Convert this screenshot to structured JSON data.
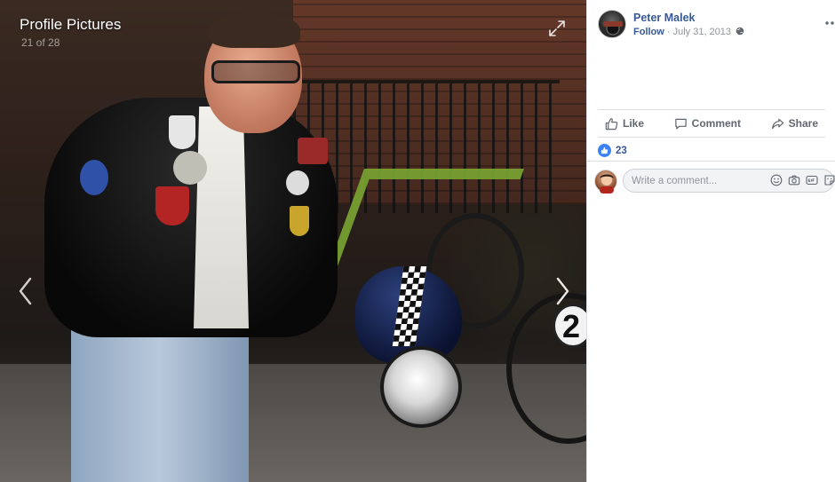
{
  "viewer": {
    "title": "Profile Pictures",
    "counter": "21 of 28",
    "photo_overlay_number": "2"
  },
  "post": {
    "author": "Peter Malek",
    "follow_label": "Follow",
    "separator": " · ",
    "date": "July 31, 2013",
    "privacy_icon": "globe-icon"
  },
  "actions": {
    "like": "Like",
    "comment": "Comment",
    "share": "Share"
  },
  "reactions": {
    "count": "23"
  },
  "comment_box": {
    "placeholder": "Write a comment..."
  },
  "colors": {
    "link_blue": "#385898",
    "like_badge": "#3b82f6",
    "muted_text": "#90949c",
    "action_text": "#606770"
  }
}
